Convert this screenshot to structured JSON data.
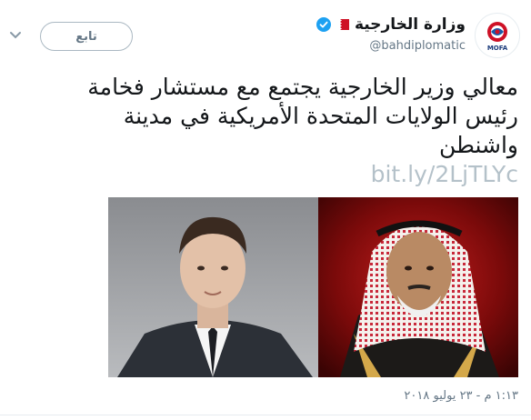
{
  "account": {
    "display_name": "وزارة الخارجية",
    "handle": "@bahdiplomatic",
    "avatar_icon": "mofa-logo-icon",
    "avatar_caption": "MOFA"
  },
  "follow_label": "تابع",
  "tweet": {
    "lines": [
      "معالي وزير الخارجية يجتمع مع مستشار فخامة",
      "رئيس الولايات المتحدة الأمريكية في مدينة",
      "واشنطن"
    ],
    "link": "bit.ly/2LjTLYc"
  },
  "timestamp": "١:١٣ م - ٢٣ يوليو ٢٠١٨",
  "colors": {
    "accent": "#1da1f2",
    "bahrain_red": "#ce1126",
    "text_secondary": "#657786",
    "link_muted": "#b4c1c9"
  }
}
